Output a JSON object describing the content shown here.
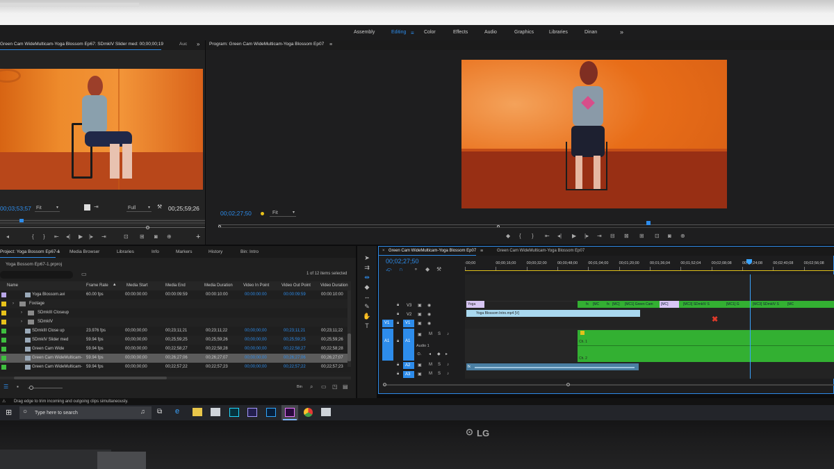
{
  "workspace": {
    "tabs": [
      "Assembly",
      "Editing",
      "Color",
      "Effects",
      "Audio",
      "Graphics",
      "Libraries",
      "Dinan"
    ],
    "active": "Editing",
    "more": "»"
  },
  "source": {
    "title": "Green Cam WideMulticam-Yoga Blossom Ep67: SDmkIV Slider med: 00;00;00;19",
    "tab2": "Auc",
    "timecode": "00;03;53;57",
    "fit": "Fit",
    "resolution": "Full",
    "duration": "00;25;59;26"
  },
  "program": {
    "title": "Program: Green Cam WideMulticam-Yoga Blossom Ep07",
    "timecode": "00;02;27;50",
    "fit": "Fit"
  },
  "project": {
    "tabs": [
      "Project: Yoga Bossom Ep67-1",
      "Media Browser",
      "Libraries",
      "Info",
      "Markers",
      "History",
      "Bin: Intro"
    ],
    "file": "Yoga Bossom Ep67-1.prproj",
    "selection": "1 of 12 items selected",
    "columns": [
      "Name",
      "Frame Rate",
      "Media Start",
      "Media End",
      "Media Duration",
      "Video In Point",
      "Video Out Point",
      "Video Duration"
    ],
    "rows": [
      {
        "name": "Yoga Blossom.avi",
        "fps": "60.00 fps",
        "start": "00:00:00:00",
        "end": "00:00:09:59",
        "dur": "00:00:10:00",
        "in": "00:00:00:00",
        "out": "00:00:09:59",
        "vdur": "00:00:10:00",
        "color": "#b9a7e8",
        "indent": 1
      },
      {
        "name": "Footage",
        "fps": "",
        "start": "",
        "end": "",
        "dur": "",
        "in": "",
        "out": "",
        "vdur": "",
        "color": "#e7c21a",
        "indent": 0,
        "folder": true
      },
      {
        "name": "SDmkIII Closeup",
        "fps": "",
        "start": "",
        "end": "",
        "dur": "",
        "in": "",
        "out": "",
        "vdur": "",
        "color": "#e7c21a",
        "indent": 1,
        "folder": true
      },
      {
        "name": "SDmkIV",
        "fps": "",
        "start": "",
        "end": "",
        "dur": "",
        "in": "",
        "out": "",
        "vdur": "",
        "color": "#e7c21a",
        "indent": 1,
        "folder": true
      },
      {
        "name": "SDmkIII Close up",
        "fps": "23.976 fps",
        "start": "00;00;00;00",
        "end": "00;23;11;21",
        "dur": "00;23;11;22",
        "in": "00;00;00;00",
        "out": "00;23;11;21",
        "vdur": "00;23;11;22",
        "color": "#3fbf3f",
        "indent": 1
      },
      {
        "name": "SDmkIV Slider med",
        "fps": "59.94 fps",
        "start": "00;00;00;00",
        "end": "00;25;59;25",
        "dur": "00;25;59;26",
        "in": "00;00;00;00",
        "out": "00;25;59;25",
        "vdur": "00;25;59;26",
        "color": "#3fbf3f",
        "indent": 1
      },
      {
        "name": "Green Cam Wide",
        "fps": "59.94 fps",
        "start": "00;00;00;00",
        "end": "00;22;58;27",
        "dur": "00;22;58;28",
        "in": "00;00;00;00",
        "out": "00;22;58;27",
        "vdur": "00;22;58;28",
        "color": "#3fbf3f",
        "indent": 1
      },
      {
        "name": "Green Cam WideMulticam-",
        "fps": "59.94 fps",
        "start": "00;00;00;00",
        "end": "00;26;27;06",
        "dur": "00;26;27;07",
        "in": "00;00;00;00",
        "out": "00;26;27;06",
        "vdur": "00;26;27;07",
        "color": "#3fbf3f",
        "indent": 1,
        "selected": true
      },
      {
        "name": "Green Cam WideMulticam-",
        "fps": "59.94 fps",
        "start": "00;00;00;00",
        "end": "00;22;57;22",
        "dur": "00;22;57;23",
        "in": "00;00;00;00",
        "out": "00;22;57;22",
        "vdur": "00;22;57;23",
        "color": "#3fbf3f",
        "indent": 1
      }
    ],
    "bin": "Bin"
  },
  "timeline": {
    "tabs": [
      "Green Cam WideMulticam-Yoga Blossom Ep07",
      "Green Cam WideMulticam-Yoga Blossom Ep07"
    ],
    "close": "×",
    "timecode": "00;02;27;50",
    "ruler": [
      ":00;00",
      "00;00;16;00",
      "00;00;32;00",
      "00;00;48;00",
      "00;01;04;00",
      "00;01;20;00",
      "00;01;36;04",
      "00;01;52;04",
      "00;02;08;08",
      "00;02;24;08",
      "00;02;40;08",
      "00;02;56;08"
    ],
    "tracks": {
      "v3": "V3",
      "v2": "V2",
      "v1": "V1",
      "a1": "A1",
      "a2": "A2",
      "a3": "A3",
      "src_v1": "V1",
      "src_a1": "A1",
      "audio1": "Audio 1"
    },
    "clips": {
      "v3_first": "Yoga",
      "v3_mc": [
        "fx",
        "[MC",
        "fx",
        "[MC]",
        "[MC1] Green Cam",
        "[MC]",
        "[MC3] SDmkIV S",
        "[MC1] G",
        "[MC3] SDmkIV S",
        "[MC"
      ],
      "v2": "Yoga Blossom Intro.mp4 [V]",
      "ch1": "Ch. 1",
      "ch2": "Ch. 2",
      "a2_first": "fx"
    }
  },
  "status": {
    "hint": "Drag edge to trim incoming and outgoing clips simultaneously."
  },
  "taskbar": {
    "search": "Type here to search"
  },
  "monitor": {
    "brand": "LG"
  },
  "colors": {
    "accent": "#2d8ceb",
    "orange": "#e8701e",
    "clip_green": "#33b032",
    "clip_blue": "#a9d8ef",
    "clip_violet": "#d7c6f4",
    "playhead": "#3aa4ff"
  }
}
